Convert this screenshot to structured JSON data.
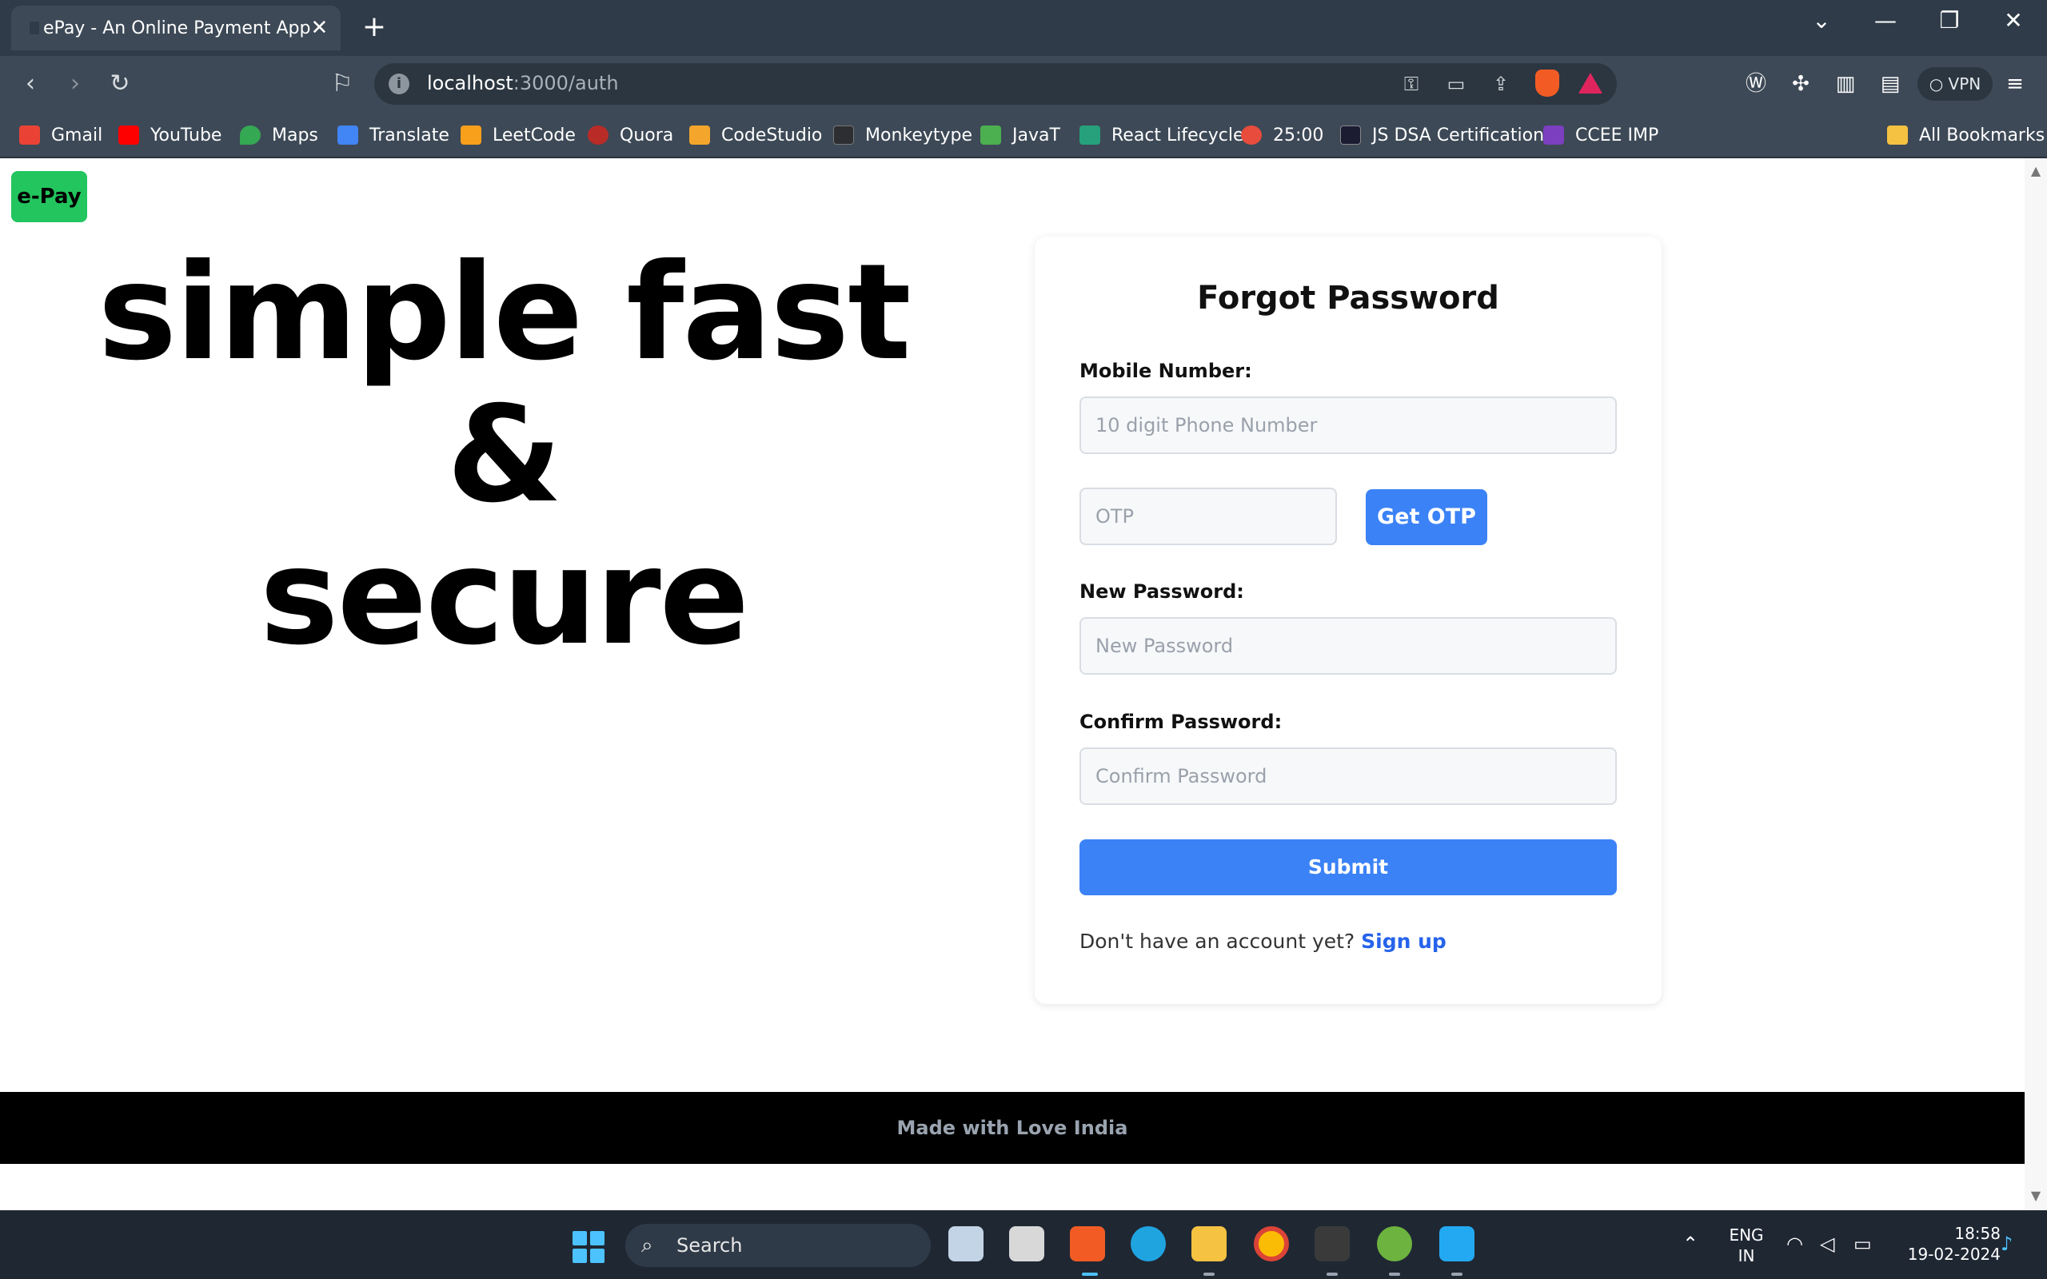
{
  "browser": {
    "tab_title": "ePay - An Online Payment App",
    "tab_close": "✕",
    "new_tab": "+",
    "url_host": "localhost",
    "url_path": ":3000/auth",
    "vpn_label": "VPN",
    "window_controls": {
      "dropdown": "⌄",
      "minimize": "—",
      "restore": "❐",
      "close": "✕"
    }
  },
  "bookmarks": {
    "items": [
      {
        "label": "Gmail",
        "color": "#ea4335"
      },
      {
        "label": "YouTube",
        "color": "#ff0000"
      },
      {
        "label": "Maps",
        "color": "#34a853"
      },
      {
        "label": "Translate",
        "color": "#4285f4"
      },
      {
        "label": "LeetCode",
        "color": "#f89f1b"
      },
      {
        "label": "Quora",
        "color": "#b92b27"
      },
      {
        "label": "CodeStudio",
        "color": "#f4a52b"
      },
      {
        "label": "Monkeytype",
        "color": "#2c2e31"
      },
      {
        "label": "JavaT",
        "color": "#4caf50"
      },
      {
        "label": "React Lifecycle",
        "color": "#26a17b"
      },
      {
        "label": "25:00",
        "color": "#e74c3c"
      },
      {
        "label": "JS DSA Certification",
        "color": "#1b1b32"
      },
      {
        "label": "CCEE IMP",
        "color": "#7b3fbf"
      }
    ],
    "all_bookmarks": "All Bookmarks"
  },
  "page": {
    "logo": "e-Pay",
    "hero_line1": "simple fast &",
    "hero_line2": "secure",
    "form": {
      "title": "Forgot Password",
      "mobile_label": "Mobile Number:",
      "mobile_placeholder": "10 digit Phone Number",
      "otp_placeholder": "OTP",
      "get_otp_button": "Get OTP",
      "new_password_label": "New Password:",
      "new_password_placeholder": "New Password",
      "confirm_password_label": "Confirm Password:",
      "confirm_password_placeholder": "Confirm Password",
      "submit_button": "Submit",
      "signup_prompt": "Don't have an account yet?",
      "signup_link": "Sign up"
    },
    "footer": "Made with Love India"
  },
  "taskbar": {
    "search_label": "Search",
    "language_top": "ENG",
    "language_bottom": "IN",
    "time": "18:58",
    "date": "19-02-2024"
  },
  "colors": {
    "accent": "#3b82f6",
    "logo_green": "#22c55e",
    "link": "#2563eb"
  }
}
